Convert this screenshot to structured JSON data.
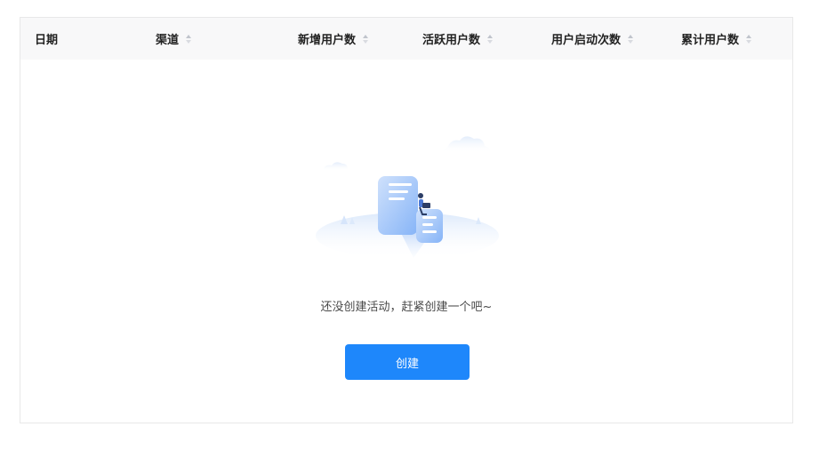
{
  "table": {
    "columns": [
      {
        "label": "日期",
        "sortable": false
      },
      {
        "label": "渠道",
        "sortable": true
      },
      {
        "label": "新增用户数",
        "sortable": true
      },
      {
        "label": "活跃用户数",
        "sortable": true
      },
      {
        "label": "用户启动次数",
        "sortable": true
      },
      {
        "label": "累计用户数",
        "sortable": true
      }
    ]
  },
  "empty_state": {
    "illustration_icon": "empty-documents-illustration",
    "message": "还没创建活动，赶紧创建一个吧~",
    "create_button_label": "创建"
  },
  "colors": {
    "primary": "#1e87fb",
    "header_bg": "#f8f8f9",
    "border": "#e8e8e8"
  }
}
